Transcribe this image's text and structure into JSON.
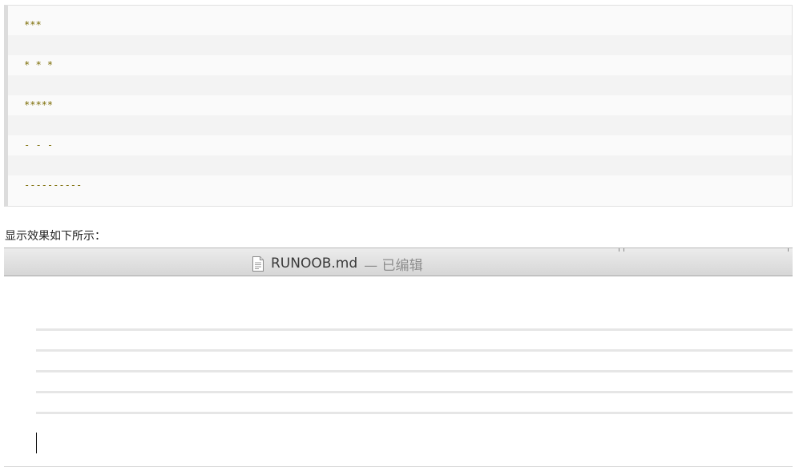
{
  "code_block": {
    "lines": [
      "***",
      "",
      "* * *",
      "",
      "*****",
      "",
      "- - -",
      "",
      "----------"
    ]
  },
  "caption": "显示效果如下所示：",
  "window": {
    "icon": "document-icon",
    "file_name": "RUNOOB.md",
    "status": "— 已编辑"
  },
  "editor": {
    "horizontal_rules": 5
  }
}
